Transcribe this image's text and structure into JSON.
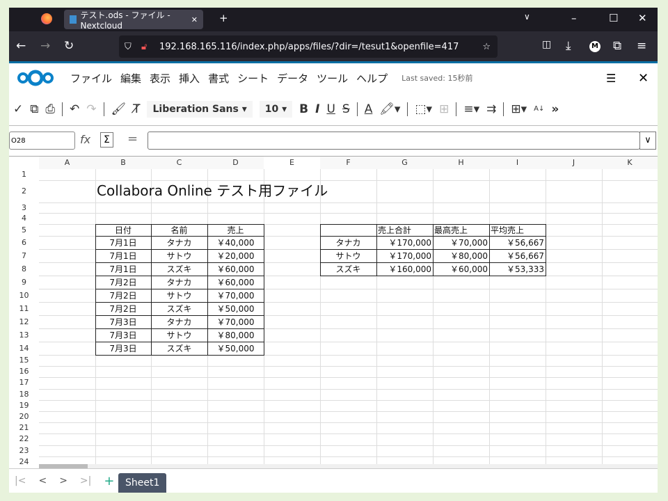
{
  "browser": {
    "tab_title": "テスト.ods - ファイル - Nextcloud",
    "url": "192.168.165.116/index.php/apps/files/?dir=/tesut1&openfile=417"
  },
  "menu": {
    "items": [
      "ファイル",
      "編集",
      "表示",
      "挿入",
      "書式",
      "シート",
      "データ",
      "ツール",
      "ヘルプ"
    ],
    "last_saved": "Last saved: 15秒前"
  },
  "toolbar": {
    "font_name": "Liberation Sans",
    "font_size": "10",
    "bold": "B",
    "italic": "I",
    "underline": "U",
    "strike": "S",
    "font_color": "A"
  },
  "formula_bar": {
    "cell_ref": "O28",
    "fx": "fx",
    "sum": "Σ",
    "equals": "=",
    "value": ""
  },
  "columns": [
    "A",
    "B",
    "C",
    "D",
    "E",
    "F",
    "G",
    "H",
    "I",
    "J",
    "K"
  ],
  "rows": [
    "1",
    "2",
    "3",
    "4",
    "5",
    "6",
    "7",
    "8",
    "9",
    "10",
    "11",
    "12",
    "13",
    "14",
    "15",
    "16",
    "17",
    "18",
    "19",
    "20",
    "21",
    "22",
    "23",
    "24"
  ],
  "title_cell": "Collabora Online テスト用ファイル",
  "sales_table": {
    "headers": [
      "日付",
      "名前",
      "売上"
    ],
    "rows": [
      [
        "7月1日",
        "タナカ",
        "￥40,000"
      ],
      [
        "7月1日",
        "サトウ",
        "￥20,000"
      ],
      [
        "7月1日",
        "スズキ",
        "￥60,000"
      ],
      [
        "7月2日",
        "タナカ",
        "￥60,000"
      ],
      [
        "7月2日",
        "サトウ",
        "￥70,000"
      ],
      [
        "7月2日",
        "スズキ",
        "￥50,000"
      ],
      [
        "7月3日",
        "タナカ",
        "￥70,000"
      ],
      [
        "7月3日",
        "サトウ",
        "￥80,000"
      ],
      [
        "7月3日",
        "スズキ",
        "￥50,000"
      ]
    ]
  },
  "summary_table": {
    "headers": [
      "",
      "売上合計",
      "最高売上",
      "平均売上"
    ],
    "rows": [
      [
        "タナカ",
        "￥170,000",
        "￥70,000",
        "￥56,667"
      ],
      [
        "サトウ",
        "￥170,000",
        "￥80,000",
        "￥56,667"
      ],
      [
        "スズキ",
        "￥160,000",
        "￥60,000",
        "￥53,333"
      ]
    ]
  },
  "sheets": {
    "active": "Sheet1"
  }
}
